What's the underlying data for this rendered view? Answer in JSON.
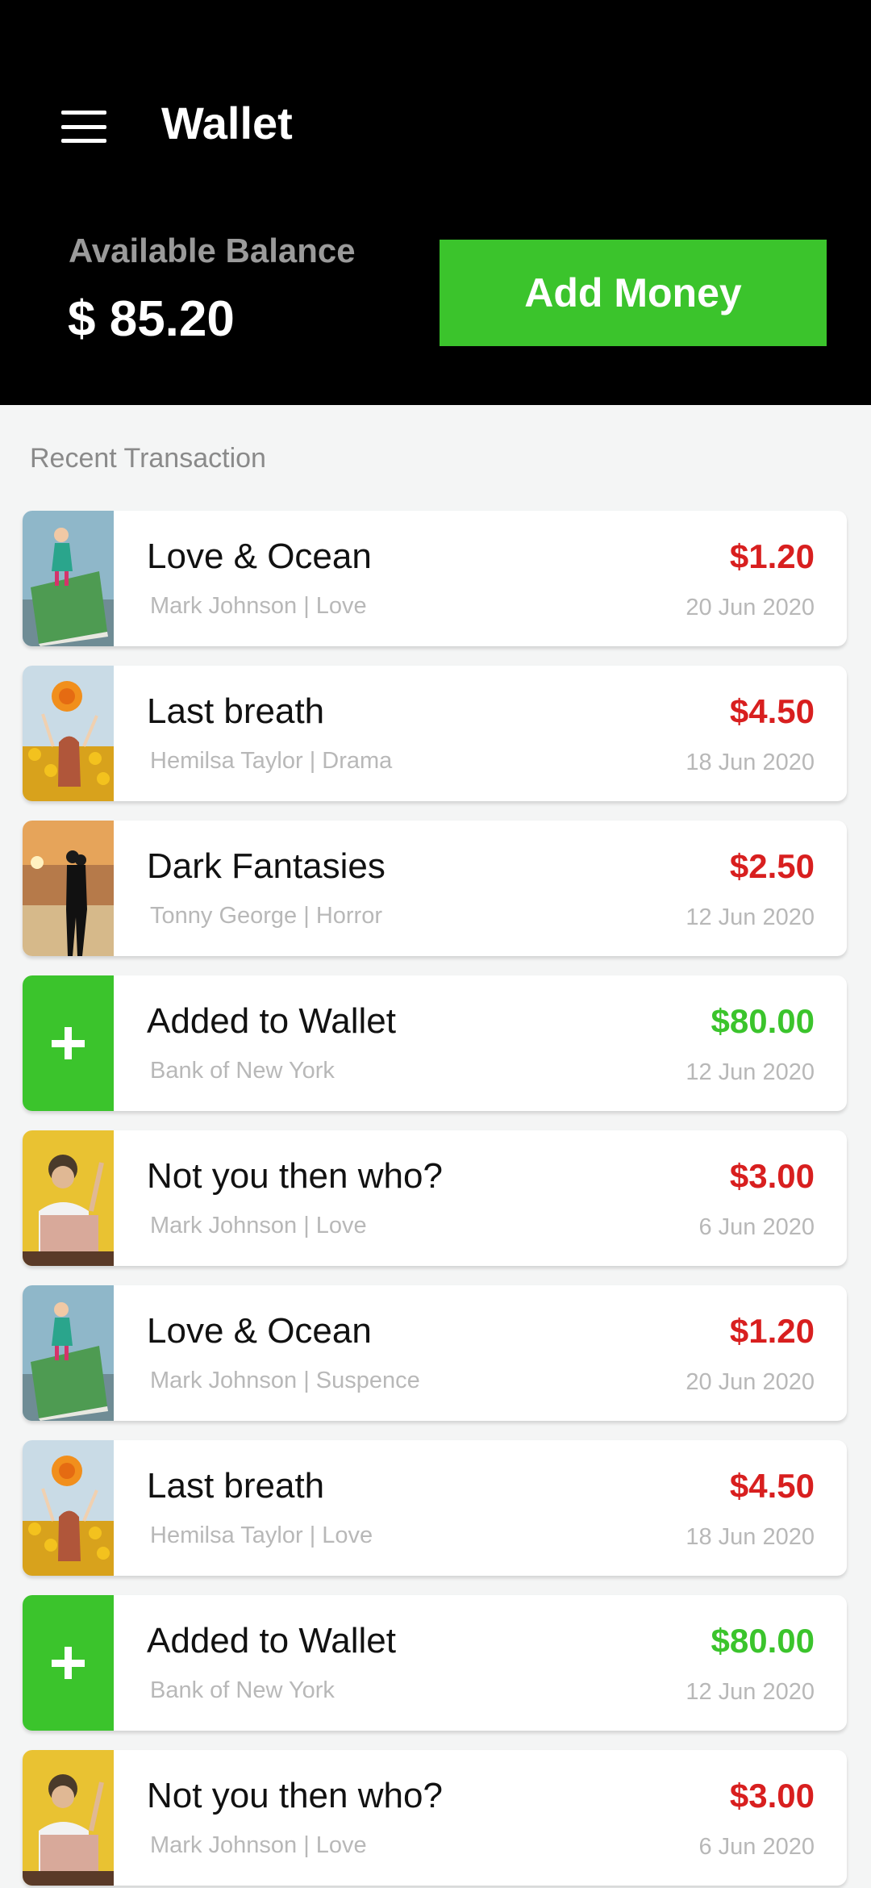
{
  "header": {
    "menu_icon": "hamburger-menu-icon",
    "title": "Wallet",
    "balance_label": "Available Balance",
    "balance_value": "$ 85.20",
    "add_money_label": "Add Money",
    "background": "#000000",
    "accent": "#3bc42c"
  },
  "section": {
    "title": "Recent Transaction"
  },
  "colors": {
    "debit": "#d81f1f",
    "credit": "#3bc42c",
    "muted": "#b8b8b8"
  },
  "transactions": [
    {
      "title": "Love & Ocean",
      "subtitle": "Mark Johnson |  Love",
      "amount": "$1.20",
      "date": "20 Jun 2020",
      "type": "debit",
      "thumb": "book-girl-thumbnail"
    },
    {
      "title": "Last breath",
      "subtitle": "Hemilsa Taylor | Drama",
      "amount": "$4.50",
      "date": "18 Jun 2020",
      "type": "debit",
      "thumb": "sunflower-girl-thumbnail"
    },
    {
      "title": "Dark Fantasies",
      "subtitle": "Tonny George |  Horror",
      "amount": "$2.50",
      "date": "12 Jun 2020",
      "type": "debit",
      "thumb": "beach-couple-thumbnail"
    },
    {
      "title": "Added to Wallet",
      "subtitle": "Bank of New York",
      "amount": "$80.00",
      "date": "12 Jun 2020",
      "type": "credit",
      "thumb": "plus-icon"
    },
    {
      "title": "Not you then who?",
      "subtitle": "Mark Johnson |  Love",
      "amount": "$3.00",
      "date": "6 Jun 2020",
      "type": "debit",
      "thumb": "laptop-man-thumbnail"
    },
    {
      "title": "Love & Ocean",
      "subtitle": "Mark Johnson |  Suspence",
      "amount": "$1.20",
      "date": "20 Jun 2020",
      "type": "debit",
      "thumb": "book-girl-thumbnail"
    },
    {
      "title": "Last breath",
      "subtitle": "Hemilsa Taylor |  Love",
      "amount": "$4.50",
      "date": "18 Jun 2020",
      "type": "debit",
      "thumb": "sunflower-girl-thumbnail"
    },
    {
      "title": "Added to Wallet",
      "subtitle": "Bank of New York",
      "amount": "$80.00",
      "date": "12 Jun 2020",
      "type": "credit",
      "thumb": "plus-icon"
    },
    {
      "title": "Not you then who?",
      "subtitle": "Mark Johnson |  Love",
      "amount": "$3.00",
      "date": "6 Jun 2020",
      "type": "debit",
      "thumb": "laptop-man-thumbnail"
    }
  ]
}
